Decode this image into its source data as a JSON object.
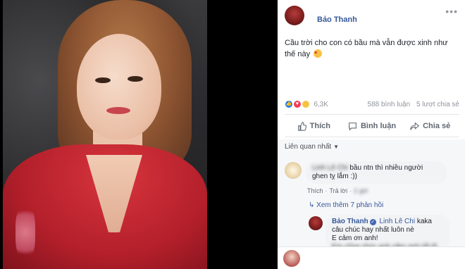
{
  "post": {
    "author": "Bảo Thanh",
    "more_label": "•••",
    "text": "Cầu trời cho con có bầu mà vẫn được xinh như thế này",
    "reactions_count": "6,3K",
    "comments_count": "588 bình luận",
    "shares_count": "5 lượt chia sẻ"
  },
  "actions": {
    "like": "Thích",
    "comment": "Bình luận",
    "share": "Chia sẻ"
  },
  "comments": {
    "filter_label": "Liên quan nhất",
    "first": {
      "text_blurred": "Linh Lê Chi",
      "text": "bầu ntn thì nhiều người ghen tỵ lắm :))",
      "like_label": "Thích",
      "reply_label": "Trả lời",
      "time_blurred": "2 giờ"
    },
    "view_replies": "Xem thêm 7 phản hồi",
    "reply": {
      "author": "Bảo Thanh",
      "mention": "Linh Lê Chi",
      "text_line1": "kaka câu chúc hay nhất luôn nè",
      "text_line2": "E cảm ơn anh!",
      "text_line3": "Em cũng chúc anh năm mới tốt lộ"
    }
  },
  "colors": {
    "link": "#365899",
    "like_reaction": "#2078f4",
    "love_reaction": "#f33e58",
    "haha_reaction": "#f7c244"
  }
}
